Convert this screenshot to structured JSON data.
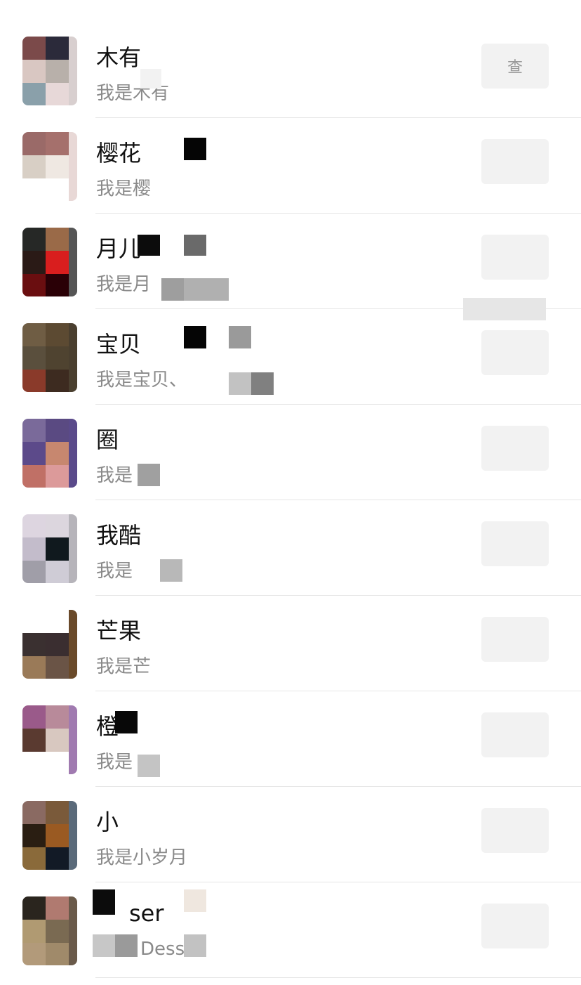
{
  "contacts": [
    {
      "name": "木有",
      "subtitle": "我是木有",
      "action": "查",
      "avatar": {
        "cells": [
          "#7b4a4a",
          "#2b2a3a",
          "#d9c7c2",
          "#b8b0aa",
          "#8aa0aa",
          "#e7d8d8"
        ],
        "strip": "#d8cfcf"
      }
    },
    {
      "name": "樱花",
      "subtitle": "我是樱",
      "action": "",
      "avatar": {
        "cells": [
          "#9a6a68",
          "#a5706c",
          "#d8cfc5",
          "#efe8e2",
          "#ffffff",
          "#ffffff"
        ],
        "strip": "#e8d8d6"
      }
    },
    {
      "name": "月儿",
      "subtitle": "我是月",
      "action": "",
      "avatar": {
        "cells": [
          "#262826",
          "#9a6a48",
          "#2a1a16",
          "#d91e1e",
          "#6a0e10",
          "#2a0006"
        ],
        "strip": "#555555"
      }
    },
    {
      "name": "宝贝",
      "subtitle": "我是宝贝、",
      "action": "",
      "avatar": {
        "cells": [
          "#6f5d44",
          "#5c4a32",
          "#5a4f3d",
          "#4f4330",
          "#8a3a2a",
          "#3d2b20"
        ],
        "strip": "#4a3f2f"
      }
    },
    {
      "name": "圈",
      "subtitle": "我是",
      "action": "",
      "avatar": {
        "cells": [
          "#7a6a9a",
          "#5a4a82",
          "#5c4a8a",
          "#c7876f",
          "#c07066",
          "#dc9a9a"
        ],
        "strip": "#5a4a8a"
      }
    },
    {
      "name": "我酷",
      "subtitle": "我是",
      "action": "",
      "avatar": {
        "cells": [
          "#ddd5e0",
          "#dcd6de",
          "#c3bccb",
          "#10191e",
          "#a09ea8",
          "#cfccd6"
        ],
        "strip": "#b6b4ba"
      }
    },
    {
      "name": "芒果",
      "subtitle": "我是芒",
      "action": "",
      "avatar": {
        "cells": [
          "#ffffff",
          "#ffffff",
          "#3a3030",
          "#3a2e30",
          "#9a7a58",
          "#6a5446"
        ],
        "strip": "#6a4a2a"
      }
    },
    {
      "name": "橙",
      "subtitle": "我是",
      "action": "",
      "avatar": {
        "cells": [
          "#9a5a8a",
          "#b88a9a",
          "#5a3a30",
          "#d8c8c0",
          "#ffffff",
          "#ffffff"
        ],
        "strip": "#a07ab0"
      }
    },
    {
      "name": "小",
      "subtitle": "我是小岁月",
      "action": "",
      "avatar": {
        "cells": [
          "#8a6a62",
          "#7a5a3a",
          "#2a1e12",
          "#9a5a22",
          "#8a6a3a",
          "#121a26"
        ],
        "strip": "#5a6a7a"
      }
    },
    {
      "name": "ser",
      "subtitle": "Dess",
      "action": "",
      "avatar": {
        "cells": [
          "#2a251e",
          "#b07a70",
          "#b09a72",
          "#7a6a52",
          "#b29a7a",
          "#a08a6a"
        ],
        "strip": "#6a5a4a"
      }
    }
  ]
}
